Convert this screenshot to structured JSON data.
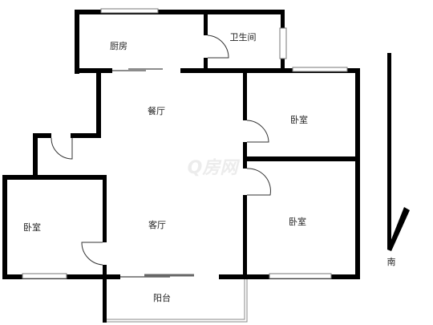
{
  "rooms": {
    "kitchen": "厨房",
    "bathroom": "卫生间",
    "dining": "餐厅",
    "bedroom_top_right": "卧室",
    "bedroom_bottom_right": "卧室",
    "bedroom_left": "卧室",
    "living": "客厅",
    "balcony": "阳台"
  },
  "compass": {
    "label": "南"
  },
  "watermark": "Q房网",
  "colors": {
    "wall": "#000000",
    "window": "#777777",
    "background": "#ffffff"
  }
}
